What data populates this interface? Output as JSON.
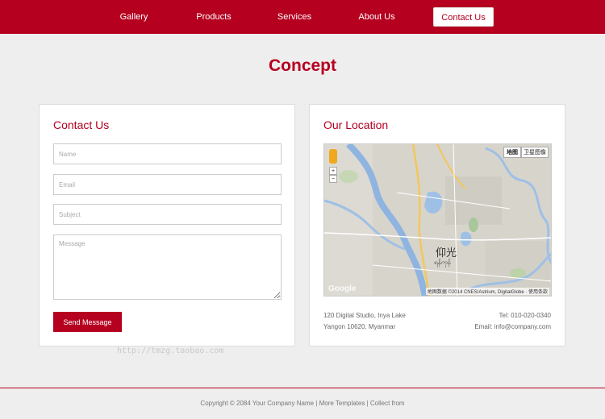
{
  "nav": {
    "items": [
      {
        "label": "Gallery"
      },
      {
        "label": "Products"
      },
      {
        "label": "Services"
      },
      {
        "label": "About Us"
      },
      {
        "label": "Contact Us",
        "active": true
      }
    ]
  },
  "page": {
    "title": "Concept"
  },
  "contact": {
    "heading": "Contact Us",
    "name_placeholder": "Name",
    "email_placeholder": "Email",
    "subject_placeholder": "Subject",
    "message_placeholder": "Message",
    "send_label": "Send Message"
  },
  "location": {
    "heading": "Our Location",
    "address_line1": "120 Digital Studio, Inya Lake",
    "address_line2": "Yangon 10620, Myanmar",
    "tel": "Tel: 010-020-0340",
    "email": "Email: info@company.com",
    "map": {
      "type_map": "地图",
      "type_satellite": "卫星图像",
      "city_label": "仰光",
      "city_sub": "ရန်ကုန်",
      "attribution": "地图数据 ©2014 CNES/Astrium, DigitalGlobe · 使用条款",
      "brand": "Google",
      "zoom_in": "+",
      "zoom_out": "−"
    }
  },
  "watermark": "http://tmzg.taobao.com",
  "footer": {
    "text": "Copyright © 2084 Your Company Name | More Templates | Collect from"
  },
  "colors": {
    "accent": "#b5001f",
    "background": "#eeeeee"
  }
}
